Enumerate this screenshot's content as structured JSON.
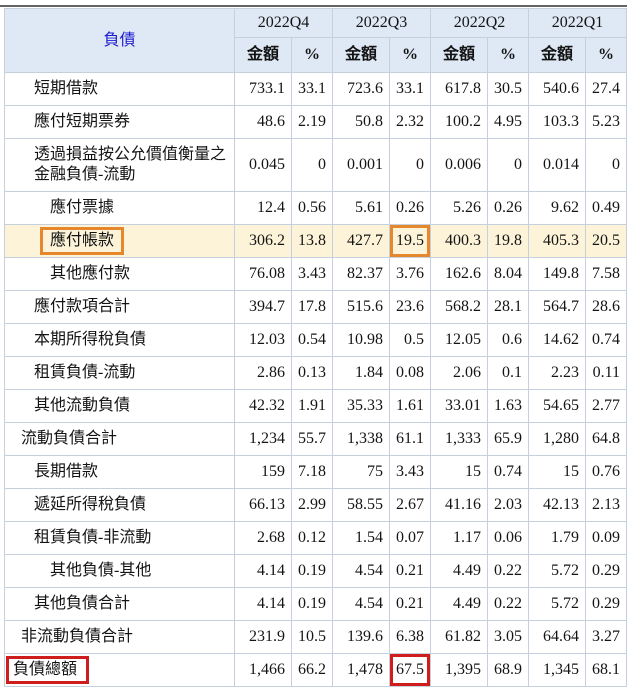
{
  "colors": {
    "header_bg": "#dfe9f5",
    "table_border": "#c6d0dc",
    "corner_label_blue": "#1d1dcf",
    "highlight_row_bg": "#fcf3d8",
    "orange_annotation": "#e5882d",
    "red_annotation": "#cf1d1d",
    "top_rule_gray": "#646464"
  },
  "table": {
    "corner_label": "負債",
    "quarters": [
      "2022Q4",
      "2022Q3",
      "2022Q2",
      "2022Q1"
    ],
    "subheaders": [
      "金額",
      "%"
    ],
    "rows": [
      {
        "label": "短期借款",
        "indent": 2,
        "values": [
          "733.1",
          "33.1",
          "723.6",
          "33.1",
          "617.8",
          "30.5",
          "540.6",
          "27.4"
        ]
      },
      {
        "label": "應付短期票券",
        "indent": 2,
        "values": [
          "48.6",
          "2.19",
          "50.8",
          "2.32",
          "100.2",
          "4.95",
          "103.3",
          "5.23"
        ]
      },
      {
        "label": "透過損益按公允價值衡量之金融負債-流動",
        "indent": 2,
        "values": [
          "0.045",
          "0",
          "0.001",
          "0",
          "0.006",
          "0",
          "0.014",
          "0"
        ]
      },
      {
        "label": "應付票據",
        "indent": 3,
        "values": [
          "12.4",
          "0.56",
          "5.61",
          "0.26",
          "5.26",
          "0.26",
          "9.62",
          "0.49"
        ]
      },
      {
        "label": "應付帳款",
        "indent": 3,
        "highlight": true,
        "label_box": "orange",
        "cell_box": {
          "index": 3,
          "color": "orange"
        },
        "values": [
          "306.2",
          "13.8",
          "427.7",
          "19.5",
          "400.3",
          "19.8",
          "405.3",
          "20.5"
        ]
      },
      {
        "label": "其他應付款",
        "indent": 3,
        "values": [
          "76.08",
          "3.43",
          "82.37",
          "3.76",
          "162.6",
          "8.04",
          "149.8",
          "7.58"
        ]
      },
      {
        "label": "應付款項合計",
        "indent": 2,
        "values": [
          "394.7",
          "17.8",
          "515.6",
          "23.6",
          "568.2",
          "28.1",
          "564.7",
          "28.6"
        ]
      },
      {
        "label": "本期所得稅負債",
        "indent": 2,
        "values": [
          "12.03",
          "0.54",
          "10.98",
          "0.5",
          "12.05",
          "0.6",
          "14.62",
          "0.74"
        ]
      },
      {
        "label": "租賃負債-流動",
        "indent": 2,
        "values": [
          "2.86",
          "0.13",
          "1.84",
          "0.08",
          "2.06",
          "0.1",
          "2.23",
          "0.11"
        ]
      },
      {
        "label": "其他流動負債",
        "indent": 2,
        "values": [
          "42.32",
          "1.91",
          "35.33",
          "1.61",
          "33.01",
          "1.63",
          "54.65",
          "2.77"
        ]
      },
      {
        "label": "流動負債合計",
        "indent": 1,
        "values": [
          "1,234",
          "55.7",
          "1,338",
          "61.1",
          "1,333",
          "65.9",
          "1,280",
          "64.8"
        ]
      },
      {
        "label": "長期借款",
        "indent": 2,
        "values": [
          "159",
          "7.18",
          "75",
          "3.43",
          "15",
          "0.74",
          "15",
          "0.76"
        ]
      },
      {
        "label": "遞延所得稅負債",
        "indent": 2,
        "values": [
          "66.13",
          "2.99",
          "58.55",
          "2.67",
          "41.16",
          "2.03",
          "42.13",
          "2.13"
        ]
      },
      {
        "label": "租賃負債-非流動",
        "indent": 2,
        "values": [
          "2.68",
          "0.12",
          "1.54",
          "0.07",
          "1.17",
          "0.06",
          "1.79",
          "0.09"
        ]
      },
      {
        "label": "其他負債-其他",
        "indent": 3,
        "values": [
          "4.14",
          "0.19",
          "4.54",
          "0.21",
          "4.49",
          "0.22",
          "5.72",
          "0.29"
        ]
      },
      {
        "label": "其他負債合計",
        "indent": 2,
        "values": [
          "4.14",
          "0.19",
          "4.54",
          "0.21",
          "4.49",
          "0.22",
          "5.72",
          "0.29"
        ]
      },
      {
        "label": "非流動負債合計",
        "indent": 1,
        "values": [
          "231.9",
          "10.5",
          "139.6",
          "6.38",
          "61.82",
          "3.05",
          "64.64",
          "3.27"
        ]
      },
      {
        "label": "負債總額",
        "indent": 0,
        "label_box": "red",
        "cell_box": {
          "index": 3,
          "color": "red"
        },
        "values": [
          "1,466",
          "66.2",
          "1,478",
          "67.5",
          "1,395",
          "68.9",
          "1,345",
          "68.1"
        ]
      }
    ]
  }
}
